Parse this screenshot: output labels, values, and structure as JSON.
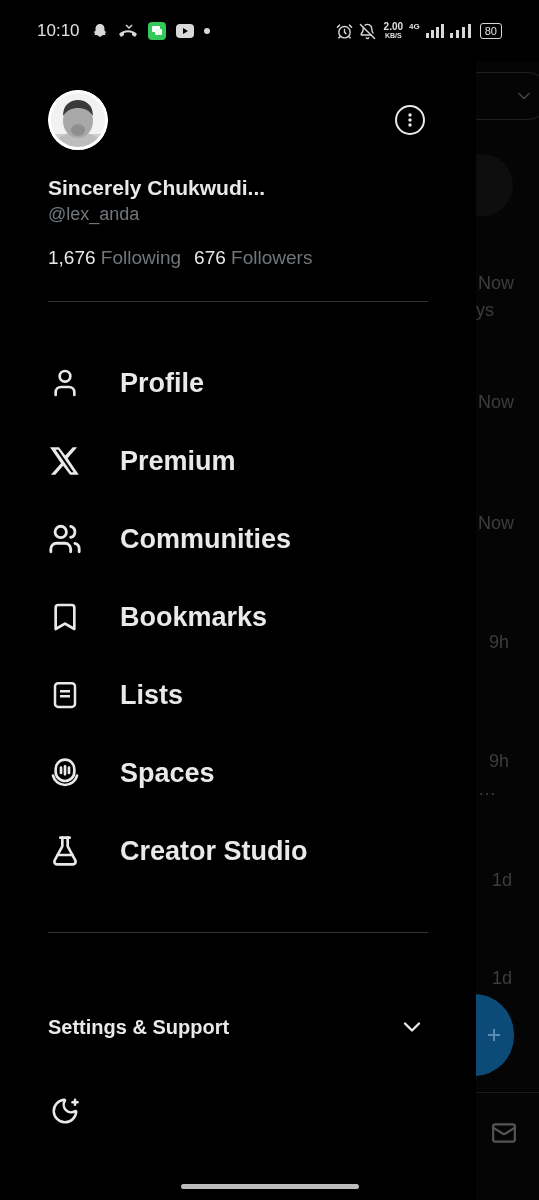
{
  "status_bar": {
    "time": "10:10",
    "network_speed": "2.00",
    "speed_unit": "KB/S",
    "network_type": "4G",
    "battery": "80"
  },
  "profile": {
    "name": "Sincerely Chukwudi...",
    "handle": "@lex_anda",
    "following_count": "1,676",
    "following_label": "Following",
    "followers_count": "676",
    "followers_label": "Followers"
  },
  "menu": [
    {
      "kind": "profile",
      "label": "Profile"
    },
    {
      "kind": "premium",
      "label": "Premium"
    },
    {
      "kind": "communities",
      "label": "Communities"
    },
    {
      "kind": "bookmarks",
      "label": "Bookmarks"
    },
    {
      "kind": "lists",
      "label": "Lists"
    },
    {
      "kind": "spaces",
      "label": "Spaces"
    },
    {
      "kind": "creator_studio",
      "label": "Creator Studio"
    }
  ],
  "settings_support": {
    "label": "Settings & Support",
    "expanded": false
  },
  "background_feed": {
    "times": [
      "Now",
      "ys",
      "Now",
      "Now",
      "9h",
      "9h",
      "…",
      "1d",
      "1d"
    ]
  }
}
